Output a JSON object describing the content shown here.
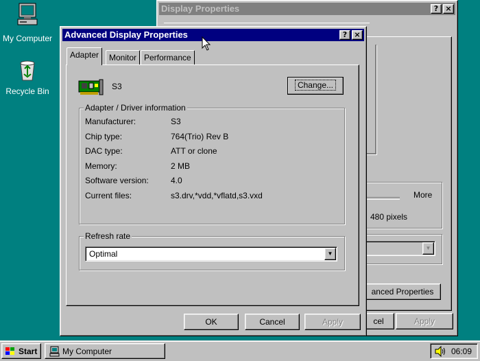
{
  "desktop": {
    "icons": [
      {
        "label": "My Computer",
        "icon": "my-computer-icon"
      },
      {
        "label": "Recycle Bin",
        "icon": "recycle-bin-icon"
      }
    ]
  },
  "display_properties": {
    "title": "Display Properties",
    "right_label": "More",
    "resolution_text": "480 pixels",
    "advanced_button": "anced Properties",
    "cancel_partial": "cel",
    "apply_label": "Apply"
  },
  "advanced": {
    "title": "Advanced Display Properties",
    "tabs": [
      {
        "label": "Adapter",
        "active": true
      },
      {
        "label": "Monitor",
        "active": false
      },
      {
        "label": "Performance",
        "active": false
      }
    ],
    "adapter_name": "S3",
    "change_button": "Change...",
    "group_title": "Adapter / Driver information",
    "info": [
      {
        "label": "Manufacturer:",
        "value": "S3"
      },
      {
        "label": "Chip type:",
        "value": "764(Trio) Rev B"
      },
      {
        "label": "DAC type:",
        "value": "ATT or clone"
      },
      {
        "label": "Memory:",
        "value": "2 MB"
      },
      {
        "label": "Software version:",
        "value": "4.0"
      },
      {
        "label": "Current files:",
        "value": "s3.drv,*vdd,*vflatd,s3.vxd"
      }
    ],
    "refresh_group": "Refresh rate",
    "refresh_value": "Optimal",
    "buttons": {
      "ok": "OK",
      "cancel": "Cancel",
      "apply": "Apply"
    },
    "title_help": "?",
    "title_close": "×"
  },
  "taskbar": {
    "start": "Start",
    "task": "My Computer",
    "clock": "06:09"
  },
  "colors": {
    "desktop": "#008080",
    "face": "#c0c0c0",
    "active_title": "#000080",
    "inactive_title": "#808080"
  }
}
